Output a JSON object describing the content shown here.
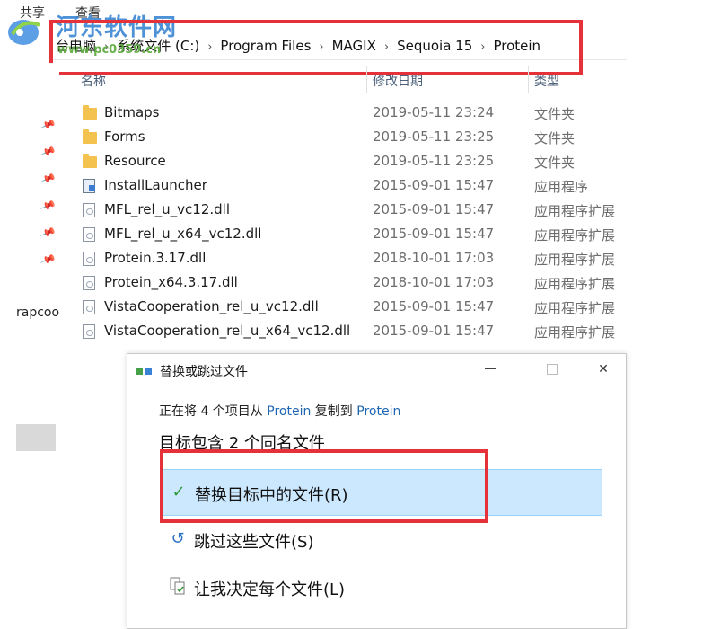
{
  "ribbon": {
    "tabs": [
      "共享",
      "查看"
    ]
  },
  "watermark": {
    "title": "河东软件网",
    "url": "www.pc0359.cn"
  },
  "addressbar": {
    "crumbs": [
      "台电脑",
      "系统文件 (C:)",
      "Program Files",
      "MAGIX",
      "Sequoia 15",
      "Protein"
    ]
  },
  "columns": {
    "name": "名称",
    "date": "修改日期",
    "type": "类型"
  },
  "leftpane": {
    "label": "rapcoo"
  },
  "files": [
    {
      "name": "Bitmaps",
      "date": "2019-05-11 23:24",
      "type": "文件夹",
      "icon": "folder-icon"
    },
    {
      "name": "Forms",
      "date": "2019-05-11 23:25",
      "type": "文件夹",
      "icon": "folder-icon"
    },
    {
      "name": "Resource",
      "date": "2019-05-11 23:25",
      "type": "文件夹",
      "icon": "folder-icon"
    },
    {
      "name": "InstallLauncher",
      "date": "2015-09-01 15:47",
      "type": "应用程序",
      "icon": "application-icon"
    },
    {
      "name": "MFL_rel_u_vc12.dll",
      "date": "2015-09-01 15:47",
      "type": "应用程序扩展",
      "icon": "dll-file-icon"
    },
    {
      "name": "MFL_rel_u_x64_vc12.dll",
      "date": "2015-09-01 15:47",
      "type": "应用程序扩展",
      "icon": "dll-file-icon"
    },
    {
      "name": "Protein.3.17.dll",
      "date": "2018-10-01 17:03",
      "type": "应用程序扩展",
      "icon": "dll-file-icon"
    },
    {
      "name": "Protein_x64.3.17.dll",
      "date": "2018-10-01 17:03",
      "type": "应用程序扩展",
      "icon": "dll-file-icon"
    },
    {
      "name": "VistaCooperation_rel_u_vc12.dll",
      "date": "2015-09-01 15:47",
      "type": "应用程序扩展",
      "icon": "dll-file-icon"
    },
    {
      "name": "VistaCooperation_rel_u_x64_vc12.dll",
      "date": "2015-09-01 15:47",
      "type": "应用程序扩展",
      "icon": "dll-file-icon"
    }
  ],
  "dialog": {
    "title": "替换或跳过文件",
    "line1_pre": "正在将 4 个项目从 ",
    "source": "Protein",
    "line1_mid": " 复制到 ",
    "dest": "Protein",
    "heading": "目标包含 2 个同名文件",
    "options": [
      {
        "label": "替换目标中的文件(R)",
        "icon": "checkmark-icon"
      },
      {
        "label": "跳过这些文件(S)",
        "icon": "skip-arrow-icon"
      },
      {
        "label": "让我决定每个文件(L)",
        "icon": "compare-files-icon"
      }
    ],
    "close_glyph": "✕"
  },
  "colors": {
    "highlight": "#e5323a",
    "selected_option": "#cce8ff",
    "link": "#1f66b3"
  }
}
